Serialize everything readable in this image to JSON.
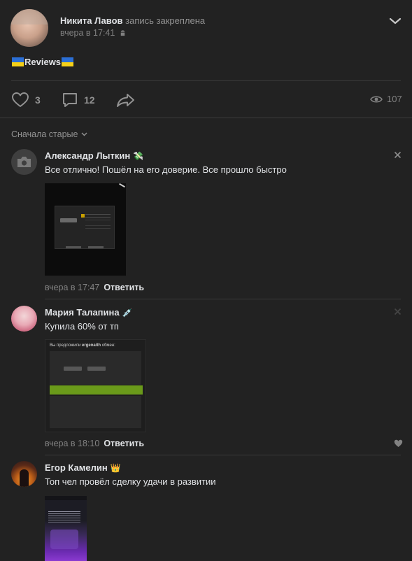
{
  "post": {
    "author": "Никита Лавов",
    "action": "запись закреплена",
    "time": "вчера в 17:41",
    "flag_left": "🇺🇦",
    "text": "Reviews",
    "flag_right": "🇺🇦"
  },
  "actions": {
    "likes": "3",
    "comments": "12",
    "views": "107"
  },
  "sort": {
    "label": "Сначала старые"
  },
  "comments": [
    {
      "author": "Александр Лыткин",
      "badge": "💸",
      "text": "Все отлично! Пошёл на его доверие. Все прошло быстро",
      "time": "вчера в 17:47",
      "reply": "Ответить"
    },
    {
      "author": "Мария Талапина",
      "badge": "💉",
      "text": "Купила 60% от тп",
      "time": "вчера в 18:10",
      "reply": "Ответить",
      "screenshot_title_prefix": "Вы предложили",
      "screenshot_title_name": "ergenaith",
      "screenshot_title_suffix": "обмен:"
    },
    {
      "author": "Егор Камелин",
      "badge": "👑",
      "text": "Топ чел провёл сделку удачи в развитии"
    }
  ],
  "colors": {
    "background": "#222222",
    "divider": "#3a3a3a",
    "text": "#e1e3e6",
    "muted": "#828282",
    "accent_green": "#6a9a1a"
  }
}
